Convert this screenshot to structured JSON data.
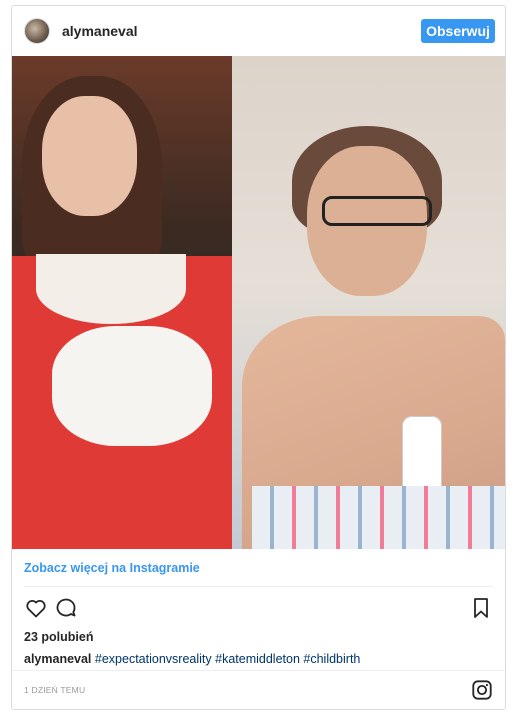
{
  "header": {
    "username": "alymaneval",
    "follow_label": "Obserwuj"
  },
  "photo": {
    "left_image": "image-left",
    "right_image": "image-right"
  },
  "link": {
    "more_label": "Zobacz więcej na Instagramie"
  },
  "actions": {
    "like_icon": "heart-icon",
    "comment_icon": "comment-icon",
    "save_icon": "bookmark-icon"
  },
  "stats": {
    "likes": "23 polubień"
  },
  "caption": {
    "user": "alymaneval",
    "tags": [
      "#expectationvsreality",
      "#katemiddleton",
      "#childbirth"
    ]
  },
  "footer": {
    "time": "1 DZIEŃ TEMU",
    "logo_icon": "instagram-icon"
  },
  "colors": {
    "accent": "#3897f0",
    "hashtag": "#003569"
  }
}
